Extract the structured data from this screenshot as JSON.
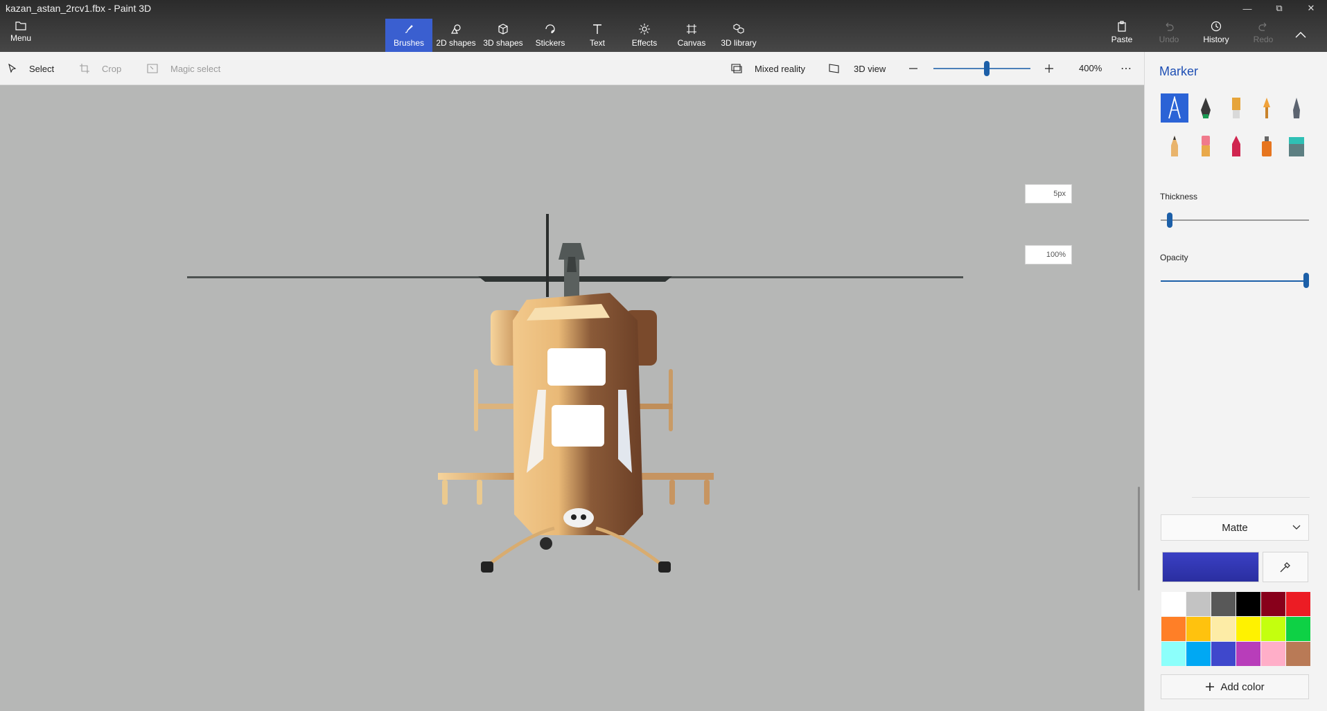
{
  "window": {
    "title": "kazan_astan_2rcv1.fbx - Paint 3D",
    "controls": [
      "minimize-icon",
      "restore-icon",
      "close-icon"
    ]
  },
  "toolbar": {
    "menu_label": "Menu",
    "tools": [
      {
        "label": "Brushes",
        "icon": "brush-icon",
        "active": true
      },
      {
        "label": "2D shapes",
        "icon": "2d-shapes-icon"
      },
      {
        "label": "3D shapes",
        "icon": "3d-shapes-icon"
      },
      {
        "label": "Stickers",
        "icon": "sticker-icon"
      },
      {
        "label": "Text",
        "icon": "text-icon"
      },
      {
        "label": "Effects",
        "icon": "effects-icon"
      },
      {
        "label": "Canvas",
        "icon": "canvas-icon"
      },
      {
        "label": "3D library",
        "icon": "3d-library-icon"
      }
    ],
    "right": {
      "paste": "Paste",
      "undo": "Undo",
      "history": "History",
      "redo": "Redo"
    }
  },
  "subbar": {
    "select": "Select",
    "crop": "Crop",
    "magic_select": "Magic select",
    "mixed_reality": "Mixed reality",
    "view_3d": "3D view",
    "zoom": "400%",
    "zoom_level": 0.55
  },
  "panel": {
    "title": "Marker",
    "thickness_label": "Thickness",
    "thickness_value": "5px",
    "thickness_level": 0.04,
    "opacity_label": "Opacity",
    "opacity_value": "100%",
    "opacity_level": 1.0,
    "finish": "Matte",
    "current_color": "#3a40c4",
    "add_color": "Add color",
    "palette": [
      "#ffffff",
      "#c3c3c3",
      "#585858",
      "#000000",
      "#88001b",
      "#ec1c24",
      "#ff7f27",
      "#ffc20e",
      "#fdeca6",
      "#fff200",
      "#c4ff0e",
      "#0ed145",
      "#8cfffb",
      "#00a8f3",
      "#3f48cc",
      "#b83dba",
      "#ffaec8",
      "#b97a56"
    ]
  },
  "colors": {
    "accent": "#2b63d6",
    "panel_title": "#1e4fb4",
    "canvas_bg": "#b6b7b6"
  }
}
